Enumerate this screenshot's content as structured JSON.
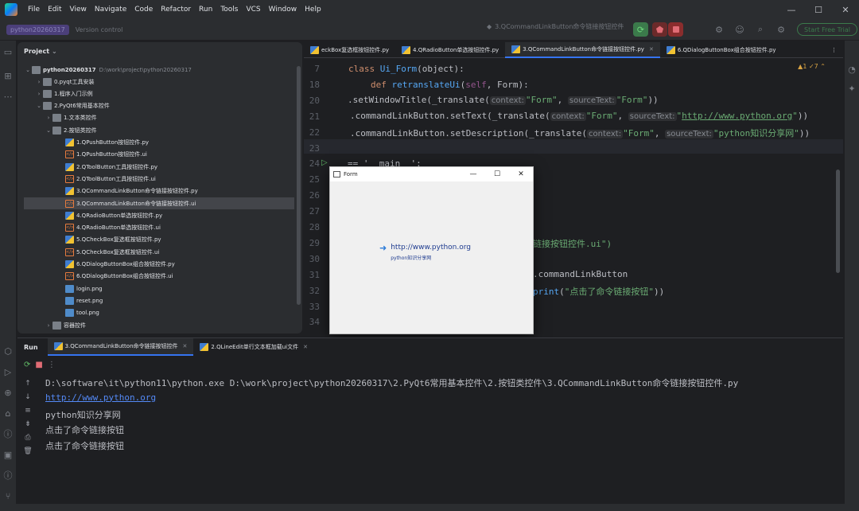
{
  "menu": [
    "File",
    "Edit",
    "View",
    "Navigate",
    "Code",
    "Refactor",
    "Run",
    "Tools",
    "VCS",
    "Window",
    "Help"
  ],
  "toolbar": {
    "project_badge": "python20260317",
    "branch": "Version control",
    "run_config": "3.QCommandLinkButton命令链接按钮控件",
    "trial_label": "Start Free Trial"
  },
  "window_controls": {
    "minimize": "—",
    "maximize": "☐",
    "close": "✕"
  },
  "project_panel": {
    "title": "Project",
    "root_name": "python20260317",
    "root_path": "D:\\work\\project\\python20260317",
    "items": [
      {
        "label": "0.pyqt工具安装",
        "kind": "folder",
        "depth": 1,
        "expanded": false
      },
      {
        "label": "1.程序入门示例",
        "kind": "folder",
        "depth": 1,
        "expanded": false
      },
      {
        "label": "2.PyQt6常用基本控件",
        "kind": "folder",
        "depth": 1,
        "expanded": true
      },
      {
        "label": "1.文本类控件",
        "kind": "folder",
        "depth": 2,
        "expanded": false
      },
      {
        "label": "2.按钮类控件",
        "kind": "folder",
        "depth": 2,
        "expanded": true
      },
      {
        "label": "1.QPushButton按钮控件.py",
        "kind": "py",
        "depth": 3
      },
      {
        "label": "1.QPushButton按钮控件.ui",
        "kind": "ui",
        "depth": 3
      },
      {
        "label": "2.QToolButton工具按钮控件.py",
        "kind": "py",
        "depth": 3
      },
      {
        "label": "2.QToolButton工具按钮控件.ui",
        "kind": "ui",
        "depth": 3
      },
      {
        "label": "3.QCommandLinkButton命令链接按钮控件.py",
        "kind": "py",
        "depth": 3
      },
      {
        "label": "3.QCommandLinkButton命令链接按钮控件.ui",
        "kind": "ui",
        "depth": 3,
        "selected": true
      },
      {
        "label": "4.QRadioButton单选按钮控件.py",
        "kind": "py",
        "depth": 3
      },
      {
        "label": "4.QRadioButton单选按钮控件.ui",
        "kind": "ui",
        "depth": 3
      },
      {
        "label": "5.QCheckBox复选框按钮控件.py",
        "kind": "py",
        "depth": 3
      },
      {
        "label": "5.QCheckBox复选框按钮控件.ui",
        "kind": "ui",
        "depth": 3
      },
      {
        "label": "6.QDialogButtonBox组合按钮控件.py",
        "kind": "py",
        "depth": 3
      },
      {
        "label": "6.QDialogButtonBox组合按钮控件.ui",
        "kind": "ui",
        "depth": 3
      },
      {
        "label": "login.png",
        "kind": "png",
        "depth": 3
      },
      {
        "label": "reset.png",
        "kind": "png",
        "depth": 3
      },
      {
        "label": "tool.png",
        "kind": "png",
        "depth": 3
      },
      {
        "label": "容器控件",
        "kind": "folder",
        "depth": 2,
        "expanded": false
      }
    ]
  },
  "editor": {
    "tabs": [
      {
        "label": "eckBox复选框按钮控件.py",
        "active": false,
        "close": false
      },
      {
        "label": "4.QRadioButton单选按钮控件.py",
        "active": false,
        "close": false
      },
      {
        "label": "3.QCommandLinkButton命令链接按钮控件.py",
        "active": true,
        "close": true
      },
      {
        "label": "6.QDialogButtonBox组合按钮控件.py",
        "active": false,
        "close": false
      }
    ],
    "inspection": "▲1 ✓7 ⌃",
    "line_numbers": [
      "7",
      "18",
      "20",
      "21",
      "22",
      "23",
      "24",
      "25",
      "26",
      "27",
      "28",
      "29",
      "30",
      "31",
      "32",
      "33",
      "34"
    ],
    "code": {
      "l7_kw": "class ",
      "l7_name": "Ui_Form",
      "l7_rest": "(object):",
      "l18_kw": "def ",
      "l18_name": "retranslateUi",
      "l18_open": "(",
      "l18_self": "self",
      "l18_rest": ", Form):",
      "l20_a": ".setWindowTitle(_translate(",
      "l20_h1": "context:",
      "l20_s1": "\"Form\"",
      "l20_c": ", ",
      "l20_h2": "sourceText:",
      "l20_s2": "\"Form\"",
      "l20_e": "))",
      "l21_a": ".commandLinkButton.setText(_translate(",
      "l21_h1": "context:",
      "l21_s1": "\"Form\"",
      "l21_c": ", ",
      "l21_h2": "sourceText:",
      "l21_q1": "\"",
      "l21_url": "http://www.python.org",
      "l21_q2": "\"",
      "l21_e": "))",
      "l22_a": ".commandLinkButton.setDescription(_translate(",
      "l22_h1": "context:",
      "l22_s1": "\"Form\"",
      "l22_c": ", ",
      "l22_h2": "sourceText:",
      "l22_s2": "\"python知识分享网\"",
      "l22_e": "))",
      "l24_a": "== '__main__':",
      "l30_str": "链接按钮控件.ui\")",
      "l32_a": ".commandLinkButton",
      "l33_fn": "print",
      "l33_open": "(",
      "l33_str": "\"点击了命令链接按钮\"",
      "l33_close": "))"
    }
  },
  "form_window": {
    "title": "Form",
    "min": "—",
    "max": "☐",
    "close": "✕",
    "link_arrow": "➜",
    "link_text": "http://www.python.org",
    "link_description": "python知识分享网"
  },
  "run_panel": {
    "title": "Run",
    "tabs": [
      {
        "label": "3.QCommandLinkButton命令链接按钮控件",
        "active": true
      },
      {
        "label": "2.QLineEdit单行文本框加载ui文件",
        "active": false
      }
    ],
    "console": [
      {
        "text": "D:\\software\\it\\python11\\python.exe D:\\work\\project\\python20260317\\2.PyQt6常用基本控件\\2.按钮类控件\\3.QCommandLinkButton命令链接按钮控件.py",
        "url": false
      },
      {
        "text": "http://www.python.org",
        "url": true
      },
      {
        "text": "python知识分享网",
        "url": false
      },
      {
        "text": "点击了命令链接按钮",
        "url": false
      },
      {
        "text": "点击了命令链接按钮",
        "url": false
      }
    ]
  }
}
